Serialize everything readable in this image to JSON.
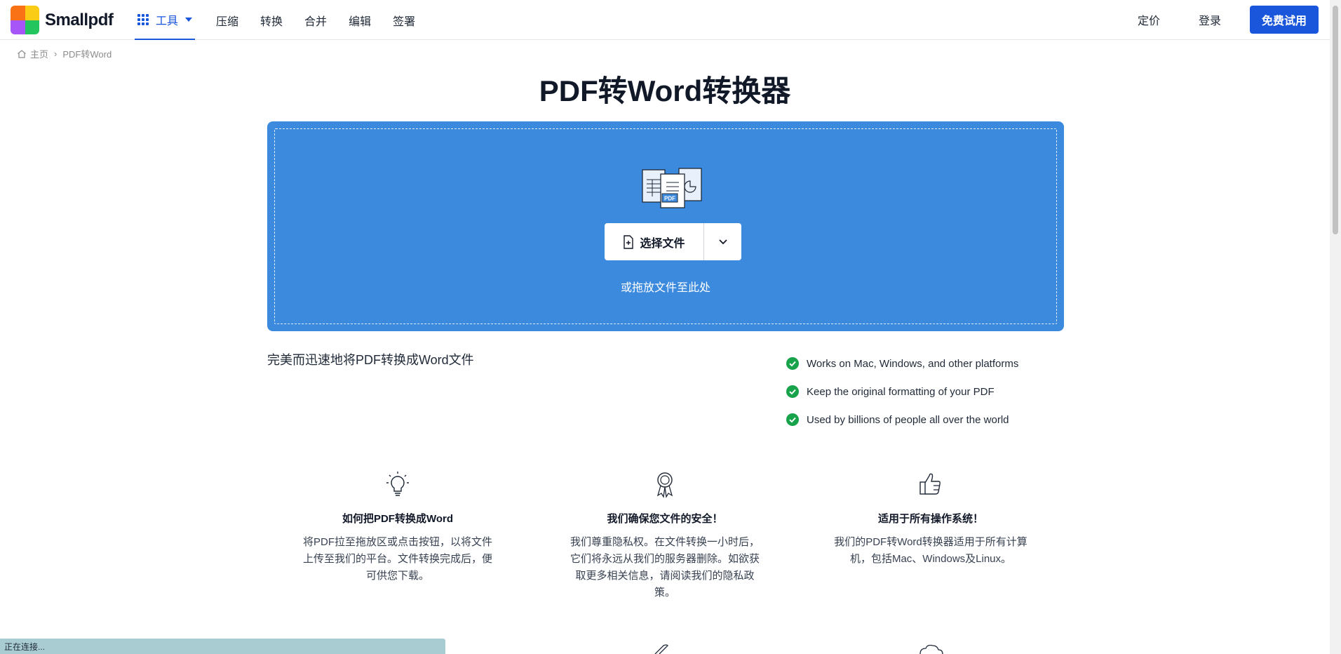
{
  "header": {
    "logo_text": "Smallpdf",
    "nav": {
      "tools_label": "工具",
      "links": [
        "压缩",
        "转换",
        "合并",
        "编辑",
        "签署"
      ]
    },
    "pricing_label": "定价",
    "login_label": "登录",
    "trial_label": "免费试用",
    "brand_color": "#1a56db"
  },
  "breadcrumb": {
    "home": "主页",
    "current": "PDF转Word"
  },
  "page_title": "PDF转Word转换器",
  "dropzone": {
    "choose_label": "选择文件",
    "hint": "或拖放文件至此处",
    "icon_badge": "PDF",
    "bg_color": "#3b8ade"
  },
  "subtitle": "完美而迅速地将PDF转换成Word文件",
  "features": [
    "Works on Mac, Windows, and other platforms",
    "Keep the original formatting of your PDF",
    "Used by billions of people all over the world"
  ],
  "cards": [
    {
      "icon": "lightbulb-icon",
      "title": "如何把PDF转换成Word",
      "body": "将PDF拉至拖放区或点击按钮，以将文件上传至我们的平台。文件转换完成后，便可供您下载。"
    },
    {
      "icon": "award-ribbon-icon",
      "title": "我们确保您文件的安全！",
      "body": "我们尊重隐私权。在文件转换一小时后，它们将永远从我们的服务器删除。如欲获取更多相关信息，请阅读我们的隐私政策。"
    },
    {
      "icon": "thumbs-up-icon",
      "title": "适用于所有操作系统！",
      "body": "我们的PDF转Word转换器适用于所有计算机，包括Mac、Windows及Linux。"
    }
  ],
  "status_bar": "正在连接..."
}
